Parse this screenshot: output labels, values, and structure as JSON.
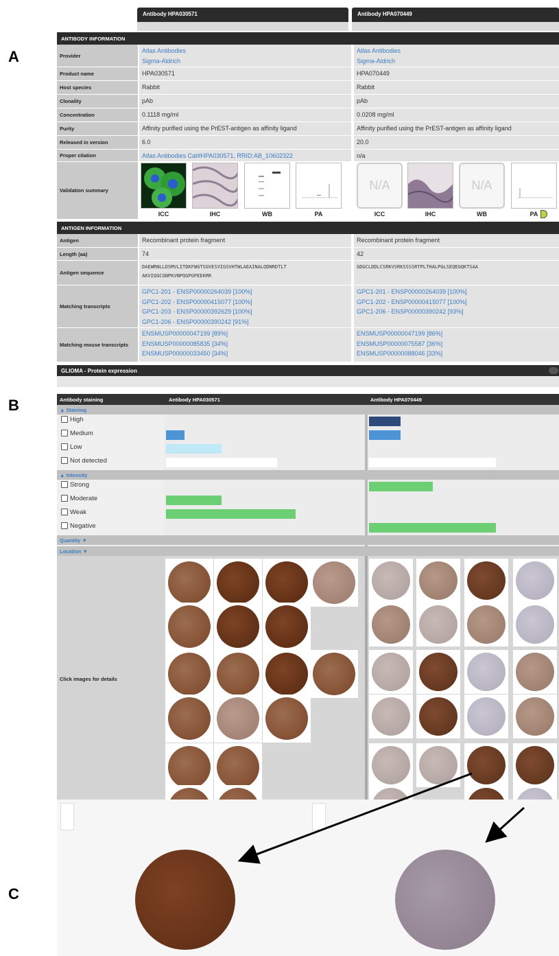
{
  "panels": [
    "A",
    "B",
    "C"
  ],
  "antibodies": [
    "Antibody HPA030571",
    "Antibody HPA070449"
  ],
  "antibody_info": {
    "title": "ANTIBODY INFORMATION",
    "rows": [
      {
        "label": "Provider",
        "v1": [
          "Atlas Antibodies",
          "Sigma-Aldrich"
        ],
        "v2": [
          "Atlas Antibodies",
          "Sigma-Aldrich"
        ]
      },
      {
        "label": "Product name",
        "v1": "HPA030571",
        "v2": "HPA070449"
      },
      {
        "label": "Host species",
        "v1": "Rabbit",
        "v2": "Rabbit"
      },
      {
        "label": "Clonality",
        "v1": "pAb",
        "v2": "pAb"
      },
      {
        "label": "Concentration",
        "v1": "0.1118 mg/ml",
        "v2": "0.0208 mg/ml"
      },
      {
        "label": "Purity",
        "v1": "Affinity purified using the PrEST-antigen as affinity ligand",
        "v2": "Affinity purified using the PrEST-antigen as affinity ligand"
      },
      {
        "label": "Released in version",
        "v1": "6.0",
        "v2": "20.0"
      },
      {
        "label": "Proper citation",
        "v1": "Atlas Antibodies Cat#HPA030571, RRID:AB_10602322",
        "v2": "n/a"
      },
      {
        "label": "Validation summary",
        "v1": [
          "ICC",
          "IHC",
          "WB",
          "PA"
        ],
        "v2": [
          "ICC",
          "IHC",
          "WB",
          "PA"
        ]
      }
    ],
    "na_text": "N/A"
  },
  "antigen_info": {
    "title": "ANTIGEN INFORMATION",
    "antigen_label": "Antigen",
    "antigen": [
      "Recombinant protein fragment",
      "Recombinant protein fragment"
    ],
    "length_label": "Length (aa)",
    "length": [
      "74",
      "42"
    ],
    "sequence_label": "Antigen sequence",
    "seq1": [
      "DAEWRNLLDSMVLITDKFWGTSGVESVIGSVHTWLAEAINALQDNRDTLT",
      "AKVIQGCGNPKVNPQGPGPEEKRR"
    ],
    "seq2": [
      "GDGCLDDLCSRKVSRKSSSSRTPLTHALPGLSEQEGQKTSAA"
    ],
    "transcripts_label": "Matching transcripts",
    "tr1": [
      "GPC1-201 - ENSP00000264039 [100%]",
      "GPC1-202 - ENSP00000415077 [100%]",
      "GPC1-203 - ENSP00000392629 [100%]",
      "GPC1-206 - ENSP00000390242 [91%]"
    ],
    "tr2": [
      "GPC1-201 - ENSP00000264039 [100%]",
      "GPC1-202 - ENSP00000415077 [100%]",
      "GPC1-206 - ENSP00000390242 [93%]"
    ],
    "mouse_label": "Matching mouse transcripts",
    "m1": [
      "ENSMUSP00000047199 [89%]",
      "ENSMUSP00000085835 [34%]",
      "ENSMUSP00000033450 [34%]"
    ],
    "m2": [
      "ENSMUSP00000047199 [86%]",
      "ENSMUSP00000075587 [36%]",
      "ENSMUSP00000088046 [33%]"
    ]
  },
  "glioma": {
    "title": "GLIOMA - Protein expression",
    "staining_header": "Antibody staining",
    "ab1": "Antibody HPA030571",
    "ab2": "Antibody HPA070449",
    "staining_label": "▲ Staining",
    "intensity_label": "▲ Intensity",
    "quantity_label": "Quantity ▼",
    "location_label": "Location ▼",
    "click_label": "Click images for details",
    "staining_levels": [
      {
        "label": "High",
        "ab1": 0,
        "ab2": 0.25,
        "color": "#2e4a7a"
      },
      {
        "label": "Medium",
        "ab1": 0.15,
        "ab2": 0.25,
        "color": "#4d94d6"
      },
      {
        "label": "Low",
        "ab1": 0.45,
        "ab2": 0,
        "color": "#bfe9f7"
      },
      {
        "label": "Not detected",
        "ab1": 0.9,
        "ab2": 1.0,
        "color": "#ffffff"
      }
    ],
    "intensity_levels": [
      {
        "label": "Strong",
        "ab1": 0,
        "ab2": 0.5,
        "color": "#6dcf73"
      },
      {
        "label": "Moderate",
        "ab1": 0.45,
        "ab2": 0,
        "color": "#6dcf73"
      },
      {
        "label": "Weak",
        "ab1": 1.05,
        "ab2": 0,
        "color": "#6dcf73"
      },
      {
        "label": "Negative",
        "ab1": 0,
        "ab2": 1.0,
        "color": "#6dcf73"
      }
    ]
  }
}
